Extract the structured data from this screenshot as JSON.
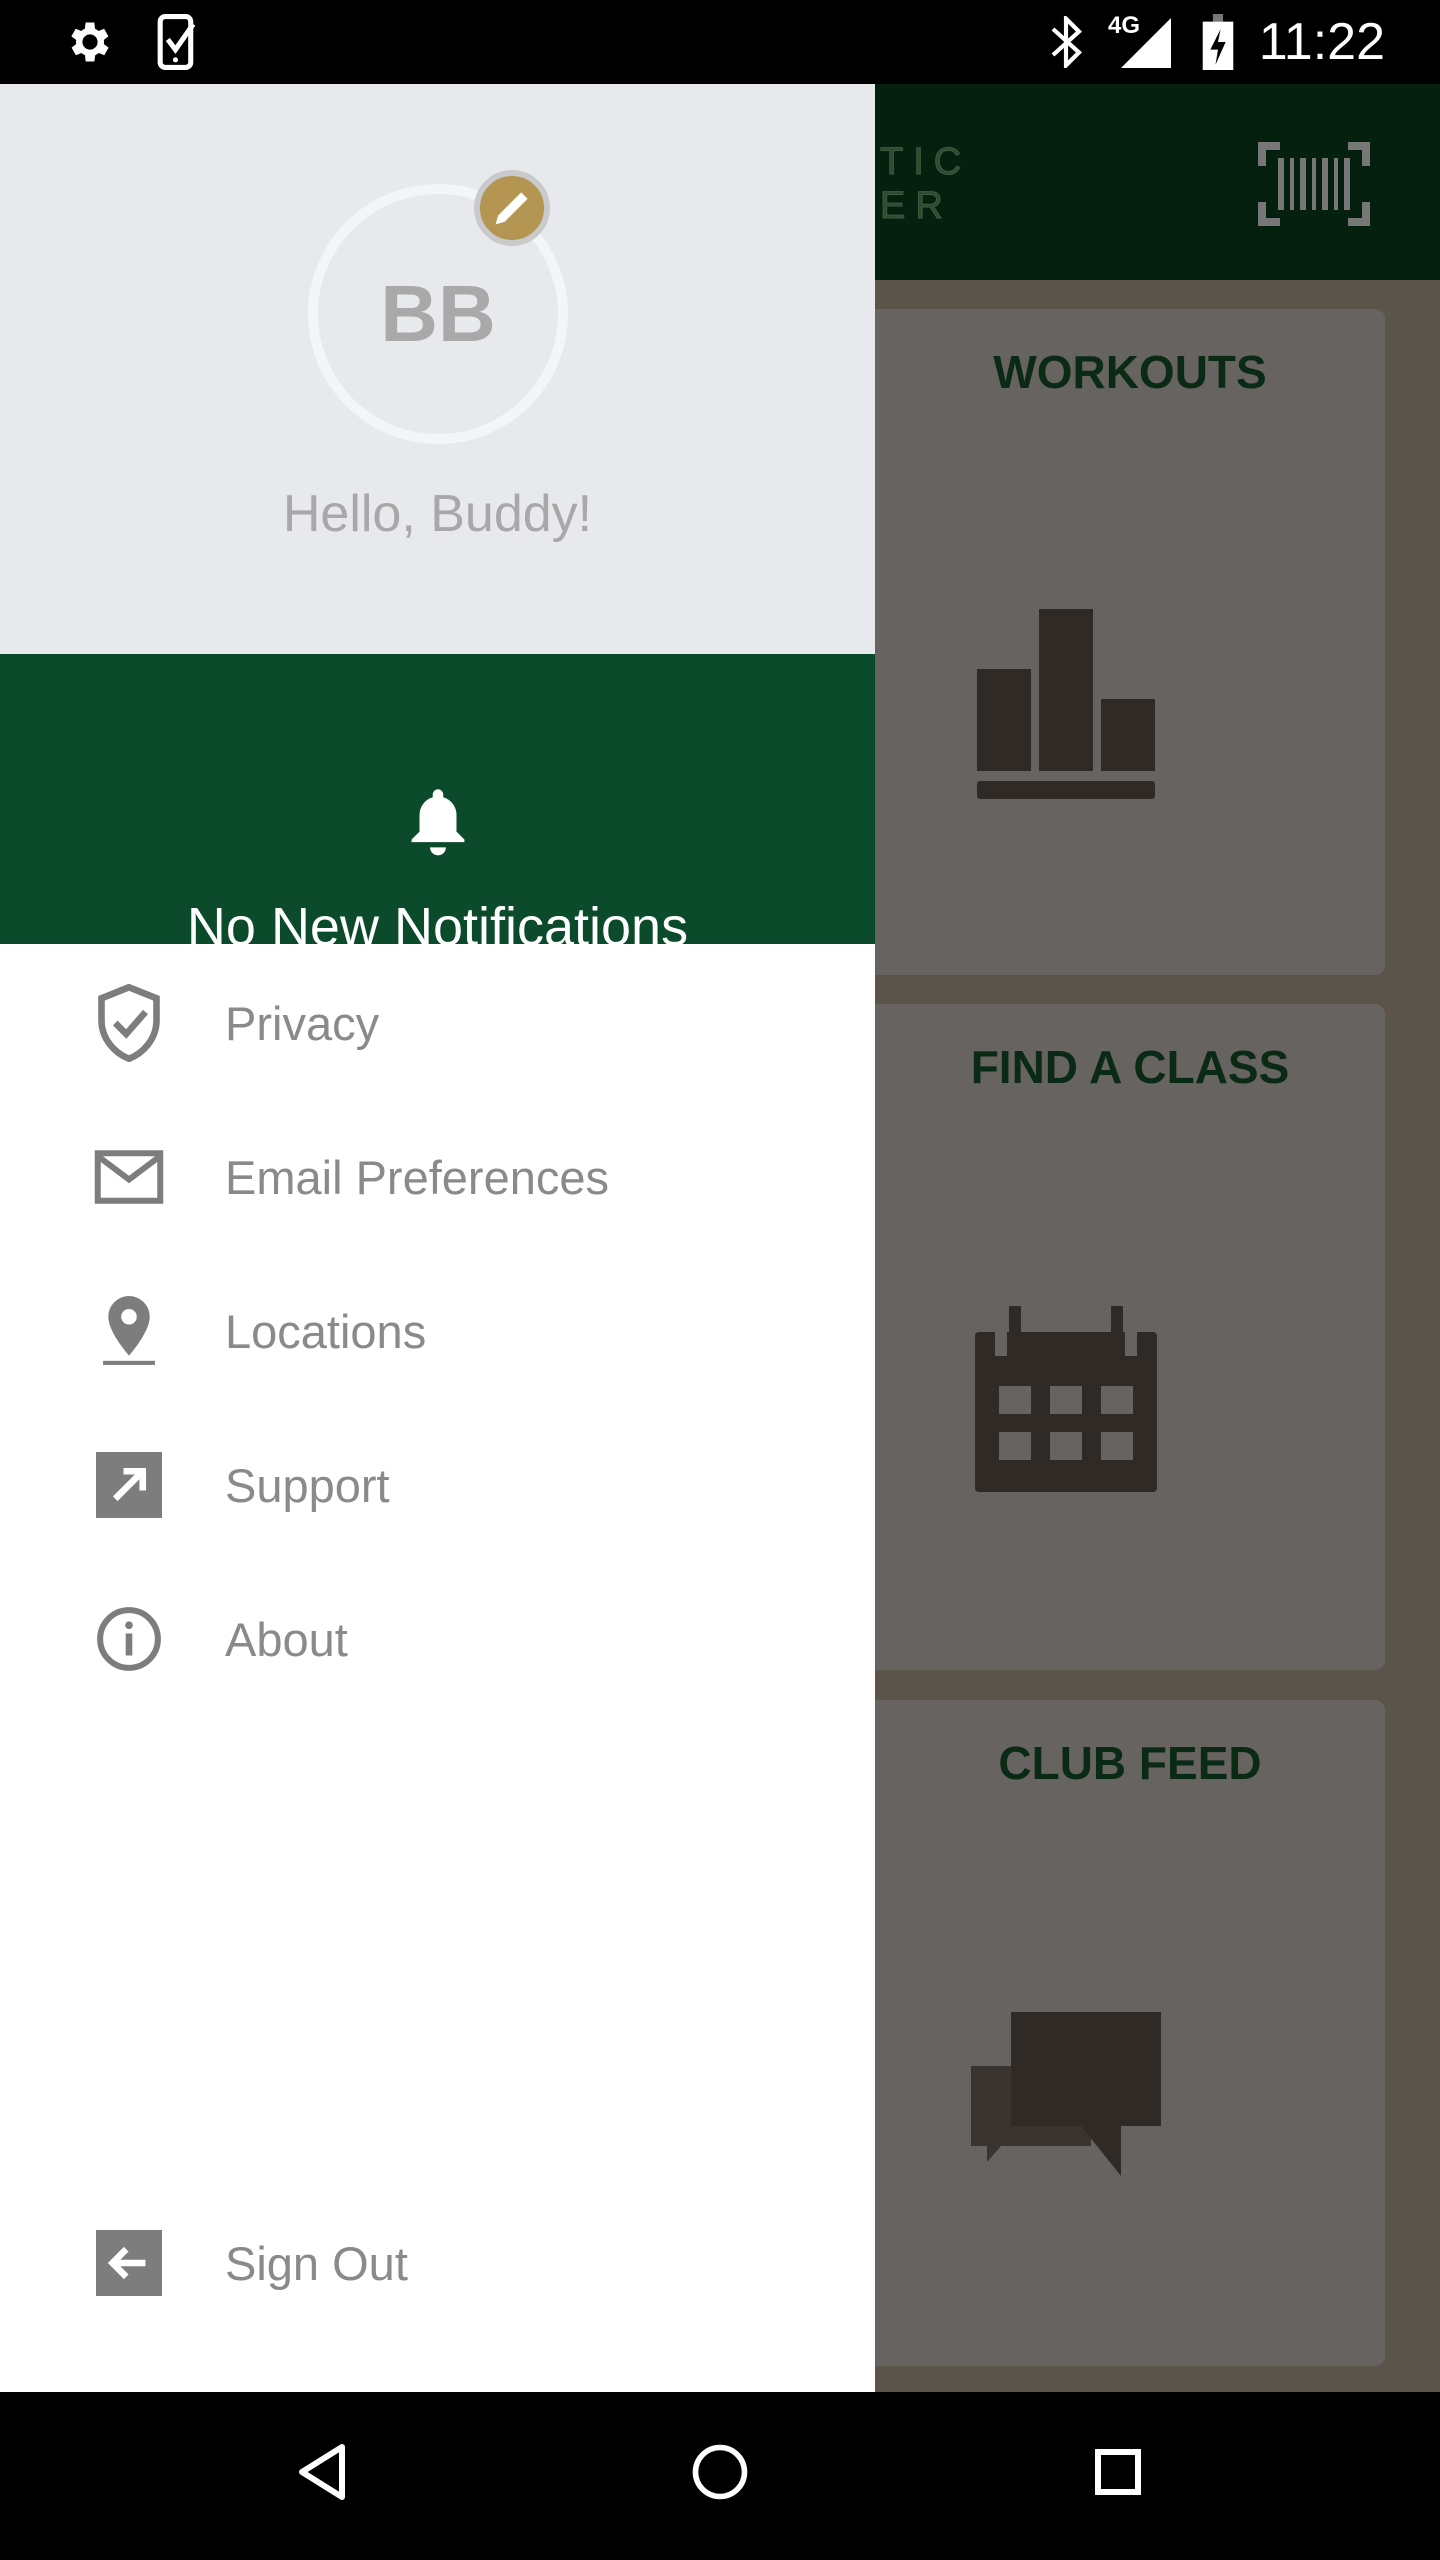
{
  "status_bar": {
    "left_icons": [
      "settings-icon",
      "phone-check-icon"
    ],
    "right_icons": [
      "bluetooth-icon",
      "signal-4g-icon",
      "battery-charging-icon"
    ],
    "network": "4G",
    "time": "11:22"
  },
  "app_bar": {
    "logo_partial": [
      "TIC",
      "ER"
    ],
    "scan_icon": "barcode-scan-icon"
  },
  "cards": [
    {
      "title": "WORKOUTS",
      "icon": "bar-chart-icon"
    },
    {
      "title": "FIND A CLASS",
      "icon": "calendar-icon"
    },
    {
      "title": "CLUB FEED",
      "icon": "chat-icon"
    }
  ],
  "drawer": {
    "avatar_initials": "BB",
    "greeting": "Hello, Buddy!",
    "notifications": "No New Notifications",
    "menu": [
      {
        "label": "Privacy",
        "icon": "shield-check-icon"
      },
      {
        "label": "Email Preferences",
        "icon": "email-icon"
      },
      {
        "label": "Locations",
        "icon": "location-pin-icon"
      },
      {
        "label": "Support",
        "icon": "external-link-icon"
      },
      {
        "label": "About",
        "icon": "info-icon"
      }
    ],
    "sign_out": "Sign Out"
  },
  "colors": {
    "drawer_header": "#e8e9ec",
    "notification_band": "#0b4a2a",
    "edit_badge": "#b49552",
    "app_bar": "#06200f",
    "card_title": "#0b2a16"
  }
}
